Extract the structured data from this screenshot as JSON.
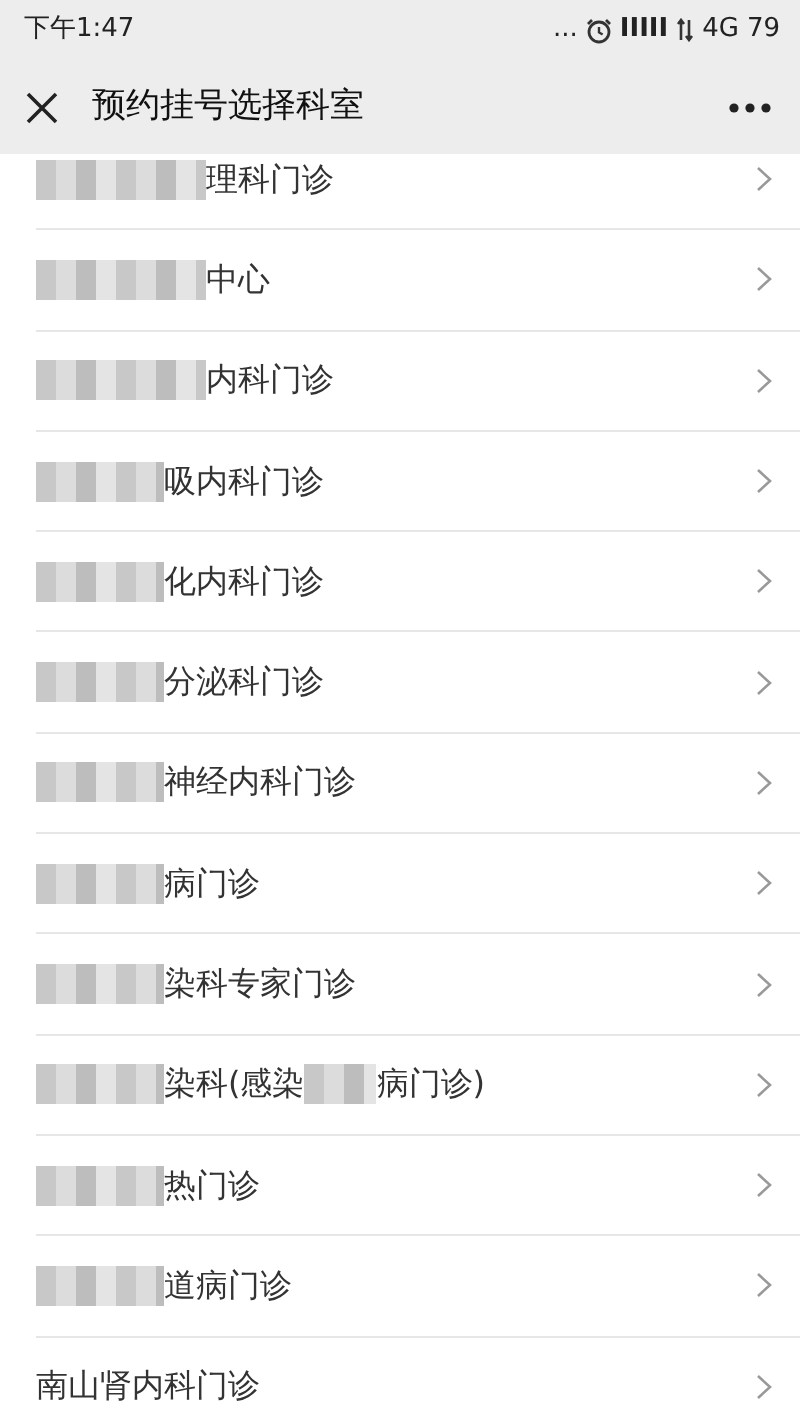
{
  "status_bar": {
    "time": "下午1:47",
    "dots": "...",
    "signal": "IIIII",
    "network": "4G",
    "battery": "79"
  },
  "header": {
    "title": "预约挂号选择科室"
  },
  "rows": [
    {
      "segments": [
        {
          "kind": "mosaic_wide"
        },
        {
          "kind": "text",
          "text": "理科门诊"
        }
      ]
    },
    {
      "segments": [
        {
          "kind": "mosaic_wide"
        },
        {
          "kind": "text",
          "text": "中心"
        }
      ]
    },
    {
      "segments": [
        {
          "kind": "mosaic_wide"
        },
        {
          "kind": "text",
          "text": "内科门诊"
        }
      ]
    },
    {
      "segments": [
        {
          "kind": "mosaic"
        },
        {
          "kind": "text",
          "text": "吸内科门诊"
        }
      ]
    },
    {
      "segments": [
        {
          "kind": "mosaic"
        },
        {
          "kind": "text",
          "text": "化内科门诊"
        }
      ]
    },
    {
      "segments": [
        {
          "kind": "mosaic"
        },
        {
          "kind": "text",
          "text": "分泌科门诊"
        }
      ]
    },
    {
      "segments": [
        {
          "kind": "mosaic"
        },
        {
          "kind": "text",
          "text": "神经内科门诊"
        }
      ]
    },
    {
      "segments": [
        {
          "kind": "mosaic"
        },
        {
          "kind": "text",
          "text": "病门诊"
        }
      ]
    },
    {
      "segments": [
        {
          "kind": "mosaic"
        },
        {
          "kind": "text",
          "text": "染科专家门诊"
        }
      ]
    },
    {
      "segments": [
        {
          "kind": "mosaic"
        },
        {
          "kind": "text",
          "text": "染科(感染"
        },
        {
          "kind": "mosaic_small"
        },
        {
          "kind": "text",
          "text": "病门诊)"
        }
      ]
    },
    {
      "segments": [
        {
          "kind": "mosaic"
        },
        {
          "kind": "text",
          "text": "热门诊"
        }
      ]
    },
    {
      "segments": [
        {
          "kind": "mosaic"
        },
        {
          "kind": "text",
          "text": "道病门诊"
        }
      ]
    },
    {
      "segments": [
        {
          "kind": "text",
          "text": "南山肾内科门诊"
        }
      ]
    }
  ]
}
